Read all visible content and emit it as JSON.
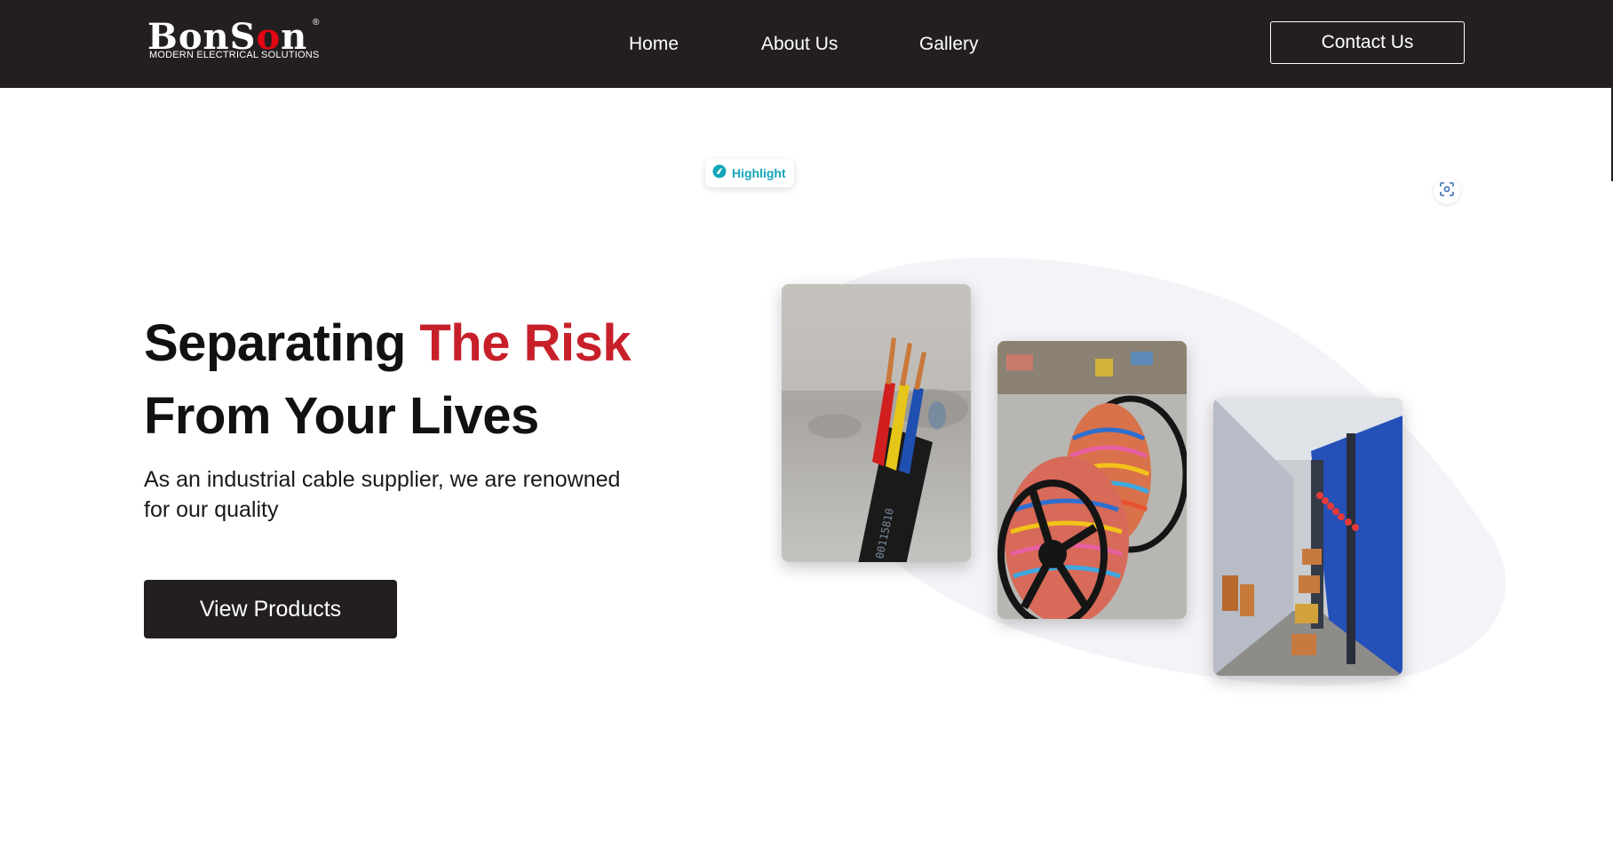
{
  "header": {
    "logo": {
      "wordmark_parts": [
        "B",
        "o",
        "nS",
        "o",
        "n"
      ],
      "registered": "®",
      "tagline": "MODERN ELECTRICAL SOLUTIONS"
    },
    "nav": {
      "home": "Home",
      "about": "About Us",
      "gallery": "Gallery"
    },
    "contact_label": "Contact Us"
  },
  "overlay": {
    "highlight_label": "Highlight",
    "highlight_icon": "highlight-icon",
    "scan_icon": "scan-icon"
  },
  "hero": {
    "title_part1": "Separating ",
    "title_accent": "The Risk",
    "title_line2": "From Your Lives",
    "subtitle": "As an industrial cable supplier, we are renowned for our quality",
    "cta_label": "View Products"
  },
  "gallery": {
    "photos": [
      {
        "subject": "three-core cable closeup",
        "cable_print": "00115810"
      },
      {
        "subject": "spools of multicolour wire"
      },
      {
        "subject": "cable production line"
      }
    ]
  },
  "colors": {
    "header_bg": "#231f20",
    "accent_red": "#c8202a",
    "highlight_teal": "#12a5b8",
    "blob": "#f4f4f8"
  }
}
